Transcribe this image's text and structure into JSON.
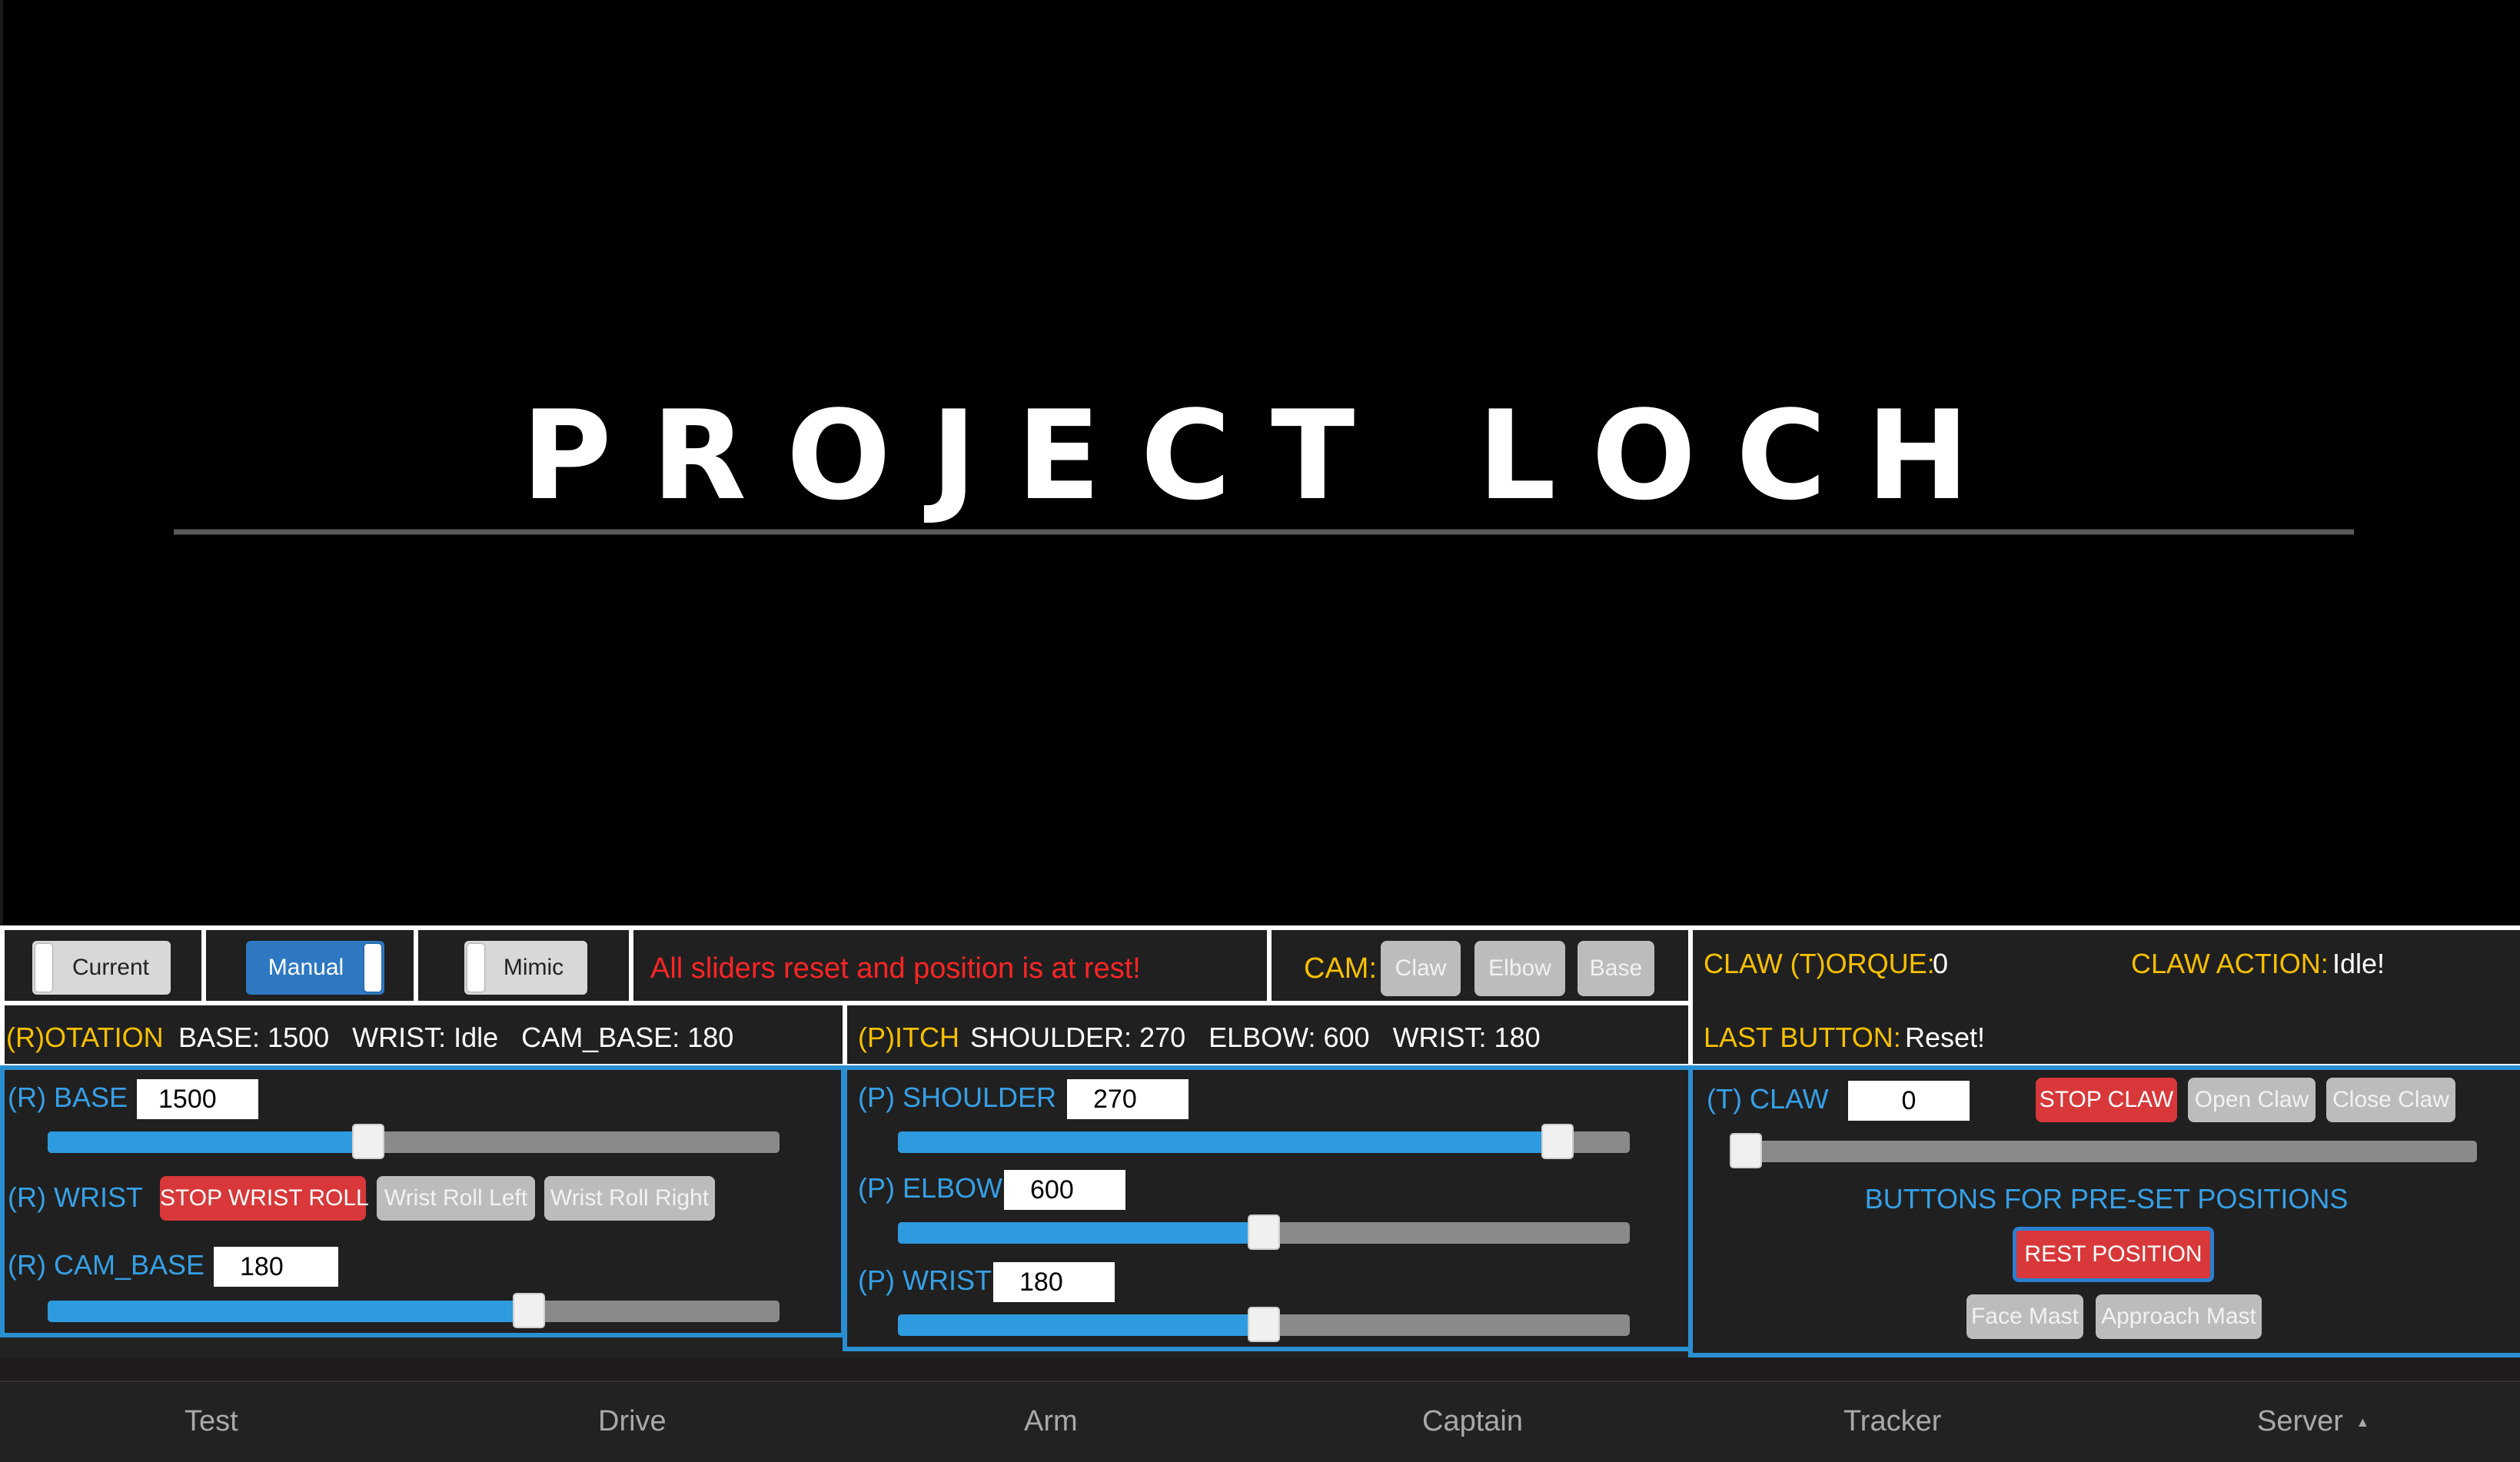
{
  "logo": {
    "text": "PROJECT LOCH"
  },
  "mode_toggles": {
    "current": "Current",
    "manual": "Manual",
    "mimic": "Mimic"
  },
  "status_message": "All sliders reset and position is at rest!",
  "cam": {
    "label": "CAM:",
    "buttons": [
      "Claw",
      "Elbow",
      "Base"
    ]
  },
  "claw_status": {
    "torque_label": "CLAW (T)ORQUE:",
    "torque_value": "0",
    "action_label": "CLAW ACTION:",
    "action_value": "Idle!",
    "last_button_label": "LAST BUTTON:",
    "last_button_value": "Reset!"
  },
  "rotation": {
    "header": "(R)OTATION",
    "summary": "BASE: 1500   WRIST: Idle   CAM_BASE: 180",
    "base_label": "(R) BASE",
    "base_value": "1500",
    "base_slider_fraction": 0.435,
    "wrist_label": "(R) WRIST",
    "wrist_buttons": [
      "STOP WRIST ROLL",
      "Wrist Roll Left",
      "Wrist Roll Right"
    ],
    "cam_base_label": "(R) CAM_BASE",
    "cam_base_value": "180",
    "cam_base_slider_fraction": 0.665
  },
  "pitch": {
    "header": "(P)ITCH",
    "summary": "SHOULDER: 270   ELBOW: 600   WRIST: 180",
    "shoulder_label": "(P) SHOULDER",
    "shoulder_value": "270",
    "shoulder_slider_fraction": 0.92,
    "elbow_label": "(P) ELBOW",
    "elbow_value": "600",
    "elbow_slider_fraction": 0.5,
    "wrist_label": "(P) WRIST",
    "wrist_value": "180",
    "wrist_slider_fraction": 0.5
  },
  "claw": {
    "label": "(T) CLAW",
    "value": "0",
    "slider_fraction": 0.0,
    "buttons": [
      "STOP CLAW",
      "Open Claw",
      "Close Claw"
    ],
    "presets_title": "BUTTONS FOR PRE-SET POSITIONS",
    "rest_button": "REST POSITION",
    "preset_buttons": [
      "Face Mast",
      "Approach Mast"
    ]
  },
  "nav": {
    "items": [
      "Test",
      "Drive",
      "Arm",
      "Captain",
      "Tracker",
      "Server"
    ],
    "server_caret": "▲"
  },
  "colors": {
    "accent_yellow": "#f8c000",
    "accent_blue": "#36a0e6",
    "alert_red": "#ff2525",
    "button_red": "#d8383a"
  }
}
